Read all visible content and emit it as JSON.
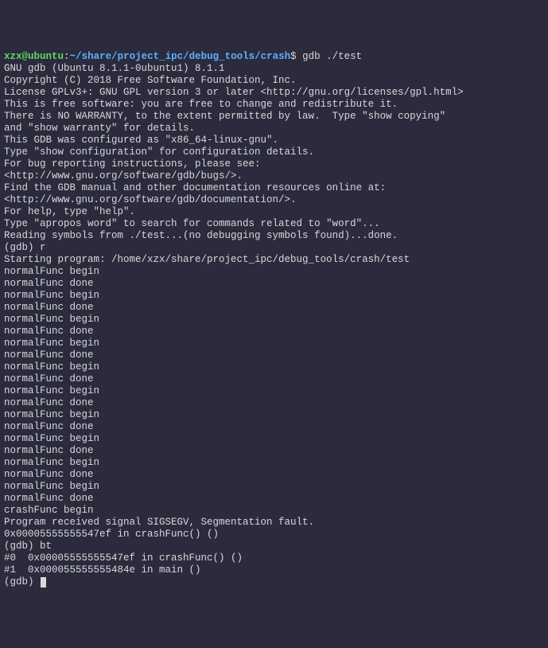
{
  "prompt": {
    "user": "xzx",
    "at": "@",
    "host": "ubuntu",
    "colon": ":",
    "path": "~/share/project_ipc/debug_tools/crash",
    "dollar": "$",
    "command": " gdb ./test"
  },
  "output": [
    "GNU gdb (Ubuntu 8.1.1-0ubuntu1) 8.1.1",
    "Copyright (C) 2018 Free Software Foundation, Inc.",
    "License GPLv3+: GNU GPL version 3 or later <http://gnu.org/licenses/gpl.html>",
    "This is free software: you are free to change and redistribute it.",
    "There is NO WARRANTY, to the extent permitted by law.  Type \"show copying\"",
    "and \"show warranty\" for details.",
    "This GDB was configured as \"x86_64-linux-gnu\".",
    "Type \"show configuration\" for configuration details.",
    "For bug reporting instructions, please see:",
    "<http://www.gnu.org/software/gdb/bugs/>.",
    "Find the GDB manual and other documentation resources online at:",
    "<http://www.gnu.org/software/gdb/documentation/>.",
    "For help, type \"help\".",
    "Type \"apropos word\" to search for commands related to \"word\"...",
    "Reading symbols from ./test...(no debugging symbols found)...done.",
    "(gdb) r",
    "Starting program: /home/xzx/share/project_ipc/debug_tools/crash/test",
    "normalFunc begin",
    "normalFunc done",
    "normalFunc begin",
    "normalFunc done",
    "normalFunc begin",
    "normalFunc done",
    "normalFunc begin",
    "normalFunc done",
    "normalFunc begin",
    "normalFunc done",
    "normalFunc begin",
    "normalFunc done",
    "normalFunc begin",
    "normalFunc done",
    "normalFunc begin",
    "normalFunc done",
    "normalFunc begin",
    "normalFunc done",
    "normalFunc begin",
    "normalFunc done",
    "crashFunc begin",
    "",
    "Program received signal SIGSEGV, Segmentation fault.",
    "0x00005555555547ef in crashFunc() ()",
    "(gdb) bt",
    "#0  0x00005555555547ef in crashFunc() ()",
    "#1  0x000055555555484e in main ()",
    "(gdb) "
  ]
}
